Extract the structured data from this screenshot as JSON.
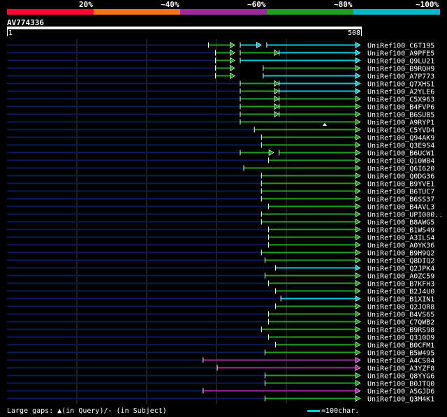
{
  "legend": {
    "segments": [
      {
        "color": "#ff0a2e"
      },
      {
        "color": "#f07814"
      },
      {
        "color": "#a028a0"
      },
      {
        "color": "#1ea01e"
      },
      {
        "color": "#00b8c8"
      }
    ],
    "labels": [
      "20%",
      "~40%",
      "~60%",
      "~80%",
      "~100%"
    ]
  },
  "query": {
    "id": "AV774336",
    "start": "1",
    "end": "508"
  },
  "rows": [
    {
      "label": "UniRef100_C6T195",
      "color": "green",
      "start": 0.57,
      "segs": [
        [
          0.57,
          0.645,
          "g"
        ],
        [
          0.66,
          0.72,
          "c"
        ],
        [
          0.735,
          1.0,
          "c"
        ]
      ]
    },
    {
      "label": "UniRef100_A9PFE5",
      "color": "green",
      "start": 0.59,
      "segs": [
        [
          0.59,
          0.645,
          "g"
        ],
        [
          0.66,
          0.77,
          "g"
        ],
        [
          0.77,
          1.0,
          "c"
        ]
      ]
    },
    {
      "label": "UniRef100_Q9LU21",
      "color": "green",
      "start": 0.59,
      "segs": [
        [
          0.59,
          0.645,
          "g"
        ],
        [
          0.66,
          1.0,
          "c"
        ]
      ]
    },
    {
      "label": "UniRef100_B9RQH9",
      "color": "green",
      "start": 0.59,
      "segs": [
        [
          0.59,
          0.645,
          "g"
        ],
        [
          0.725,
          1.0,
          "g"
        ]
      ]
    },
    {
      "label": "UniRef100_A7P773",
      "color": "green",
      "start": 0.59,
      "segs": [
        [
          0.59,
          0.645,
          "g"
        ],
        [
          0.725,
          1.0,
          "c"
        ]
      ]
    },
    {
      "label": "UniRef100_Q7XHS1",
      "color": "green",
      "start": 0.66,
      "segs": [
        [
          0.66,
          0.77,
          "g"
        ],
        [
          0.77,
          1.0,
          "c"
        ]
      ]
    },
    {
      "label": "UniRef100_A2YLE6",
      "color": "green",
      "start": 0.66,
      "segs": [
        [
          0.66,
          0.77,
          "g"
        ],
        [
          0.77,
          1.0,
          "c"
        ]
      ]
    },
    {
      "label": "UniRef100_C5X963",
      "color": "green",
      "start": 0.66,
      "segs": [
        [
          0.66,
          0.77,
          "g"
        ],
        [
          0.77,
          1.0,
          "g"
        ]
      ]
    },
    {
      "label": "UniRef100_B4FVP6",
      "color": "green",
      "start": 0.66,
      "segs": [
        [
          0.66,
          0.77,
          "g"
        ],
        [
          0.77,
          1.0,
          "g"
        ]
      ]
    },
    {
      "label": "UniRef100_B6SUB5",
      "color": "green",
      "start": 0.66,
      "segs": [
        [
          0.66,
          0.77,
          "g"
        ],
        [
          0.77,
          1.0,
          "g"
        ]
      ]
    },
    {
      "label": "UniRef100_A9RYP1",
      "color": "green",
      "start": 0.66,
      "segs": [
        [
          0.66,
          1.0,
          "g"
        ]
      ]
    },
    {
      "label": "UniRef100_C5YVD4",
      "color": "green",
      "start": 0.7,
      "segs": [
        [
          0.7,
          1.0,
          "g"
        ]
      ]
    },
    {
      "label": "UniRef100_Q94AK9",
      "color": "green",
      "start": 0.72,
      "segs": [
        [
          0.72,
          1.0,
          "g"
        ]
      ]
    },
    {
      "label": "UniRef100_Q3E9S4",
      "color": "green",
      "start": 0.72,
      "segs": [
        [
          0.72,
          1.0,
          "g"
        ]
      ]
    },
    {
      "label": "UniRef100_B6UCW1",
      "color": "green",
      "start": 0.66,
      "segs": [
        [
          0.66,
          0.755,
          "g"
        ],
        [
          0.77,
          1.0,
          "g"
        ]
      ]
    },
    {
      "label": "UniRef100_Q10W84",
      "color": "green",
      "start": 0.74,
      "segs": [
        [
          0.74,
          1.0,
          "g"
        ]
      ]
    },
    {
      "label": "UniRef100_Q6I620",
      "color": "green",
      "start": 0.67,
      "segs": [
        [
          0.67,
          1.0,
          "g"
        ]
      ]
    },
    {
      "label": "UniRef100_Q0DG36",
      "color": "green",
      "start": 0.72,
      "segs": [
        [
          0.72,
          1.0,
          "g"
        ]
      ]
    },
    {
      "label": "UniRef100_B9YVE1",
      "color": "green",
      "start": 0.72,
      "segs": [
        [
          0.72,
          1.0,
          "g"
        ]
      ]
    },
    {
      "label": "UniRef100_B6TUC7",
      "color": "green",
      "start": 0.72,
      "segs": [
        [
          0.72,
          1.0,
          "g"
        ]
      ]
    },
    {
      "label": "UniRef100_B6SS37",
      "color": "green",
      "start": 0.72,
      "segs": [
        [
          0.72,
          1.0,
          "g"
        ]
      ]
    },
    {
      "label": "UniRef100_B4AVL3",
      "color": "green",
      "start": 0.74,
      "segs": [
        [
          0.74,
          1.0,
          "g"
        ]
      ]
    },
    {
      "label": "UniRef100_UPI000..",
      "color": "green",
      "start": 0.72,
      "segs": [
        [
          0.72,
          1.0,
          "g"
        ]
      ]
    },
    {
      "label": "UniRef100_B8AWG5",
      "color": "green",
      "start": 0.72,
      "segs": [
        [
          0.72,
          1.0,
          "g"
        ]
      ]
    },
    {
      "label": "UniRef100_B1WS49",
      "color": "green",
      "start": 0.74,
      "segs": [
        [
          0.74,
          1.0,
          "g"
        ]
      ]
    },
    {
      "label": "UniRef100_A3ILS4",
      "color": "green",
      "start": 0.74,
      "segs": [
        [
          0.74,
          1.0,
          "g"
        ]
      ]
    },
    {
      "label": "UniRef100_A0YK36",
      "color": "green",
      "start": 0.74,
      "segs": [
        [
          0.74,
          1.0,
          "g"
        ]
      ]
    },
    {
      "label": "UniRef100_B9H9Q2",
      "color": "green",
      "start": 0.72,
      "segs": [
        [
          0.72,
          1.0,
          "g"
        ]
      ]
    },
    {
      "label": "UniRef100_Q8DIQ2",
      "color": "green",
      "start": 0.73,
      "segs": [
        [
          0.73,
          1.0,
          "g"
        ]
      ]
    },
    {
      "label": "UniRef100_Q2JPK4",
      "color": "cyan",
      "start": 0.76,
      "segs": [
        [
          0.76,
          1.0,
          "c"
        ]
      ]
    },
    {
      "label": "UniRef100_A0ZC59",
      "color": "green",
      "start": 0.73,
      "segs": [
        [
          0.73,
          1.0,
          "g"
        ]
      ]
    },
    {
      "label": "UniRef100_B7KFH3",
      "color": "green",
      "start": 0.74,
      "segs": [
        [
          0.74,
          1.0,
          "g"
        ]
      ]
    },
    {
      "label": "UniRef100_B2J4U0",
      "color": "green",
      "start": 0.76,
      "segs": [
        [
          0.76,
          1.0,
          "g"
        ]
      ]
    },
    {
      "label": "UniRef100_B1XIN1",
      "color": "cyan",
      "start": 0.775,
      "segs": [
        [
          0.775,
          1.0,
          "c"
        ]
      ]
    },
    {
      "label": "UniRef100_Q2JQR8",
      "color": "green",
      "start": 0.76,
      "segs": [
        [
          0.76,
          1.0,
          "g"
        ]
      ]
    },
    {
      "label": "UniRef100_B4VS65",
      "color": "green",
      "start": 0.74,
      "segs": [
        [
          0.74,
          1.0,
          "g"
        ]
      ]
    },
    {
      "label": "UniRef100_C7QWB2",
      "color": "green",
      "start": 0.74,
      "segs": [
        [
          0.74,
          1.0,
          "g"
        ]
      ]
    },
    {
      "label": "UniRef100_B9RS98",
      "color": "green",
      "start": 0.72,
      "segs": [
        [
          0.72,
          1.0,
          "g"
        ]
      ]
    },
    {
      "label": "UniRef100_Q310D9",
      "color": "green",
      "start": 0.74,
      "segs": [
        [
          0.74,
          1.0,
          "g"
        ]
      ]
    },
    {
      "label": "UniRef100_B0CFM1",
      "color": "green",
      "start": 0.76,
      "segs": [
        [
          0.76,
          1.0,
          "g"
        ]
      ]
    },
    {
      "label": "UniRef100_B5W495",
      "color": "green",
      "start": 0.73,
      "segs": [
        [
          0.73,
          1.0,
          "g"
        ]
      ]
    },
    {
      "label": "UniRef100_A4CS04",
      "color": "purple",
      "start": 0.555,
      "segs": [
        [
          0.555,
          1.0,
          "p"
        ]
      ]
    },
    {
      "label": "UniRef100_A3YZF8",
      "color": "purple",
      "start": 0.595,
      "segs": [
        [
          0.595,
          1.0,
          "p"
        ]
      ]
    },
    {
      "label": "UniRef100_Q8YYG6",
      "color": "green",
      "start": 0.73,
      "segs": [
        [
          0.73,
          1.0,
          "g"
        ]
      ]
    },
    {
      "label": "UniRef100_B0JTQ0",
      "color": "green",
      "start": 0.73,
      "segs": [
        [
          0.73,
          1.0,
          "g"
        ]
      ]
    },
    {
      "label": "UniRef100_A5GJD6",
      "color": "purple",
      "start": 0.555,
      "segs": [
        [
          0.555,
          1.0,
          "p"
        ]
      ]
    },
    {
      "label": "UniRef100_Q3M4K1",
      "color": "green",
      "start": 0.73,
      "segs": [
        [
          0.73,
          1.0,
          "g"
        ]
      ]
    }
  ],
  "colors": {
    "g": "#1ea01e",
    "c": "#00c8d8",
    "p": "#a028a0",
    "navy": "#0a1a5a",
    "grid": "#3a3a3a"
  },
  "footer": {
    "gaps_text": "Large gaps: ▲(in Query)/- (in Subject)",
    "key_text": "=100char."
  }
}
